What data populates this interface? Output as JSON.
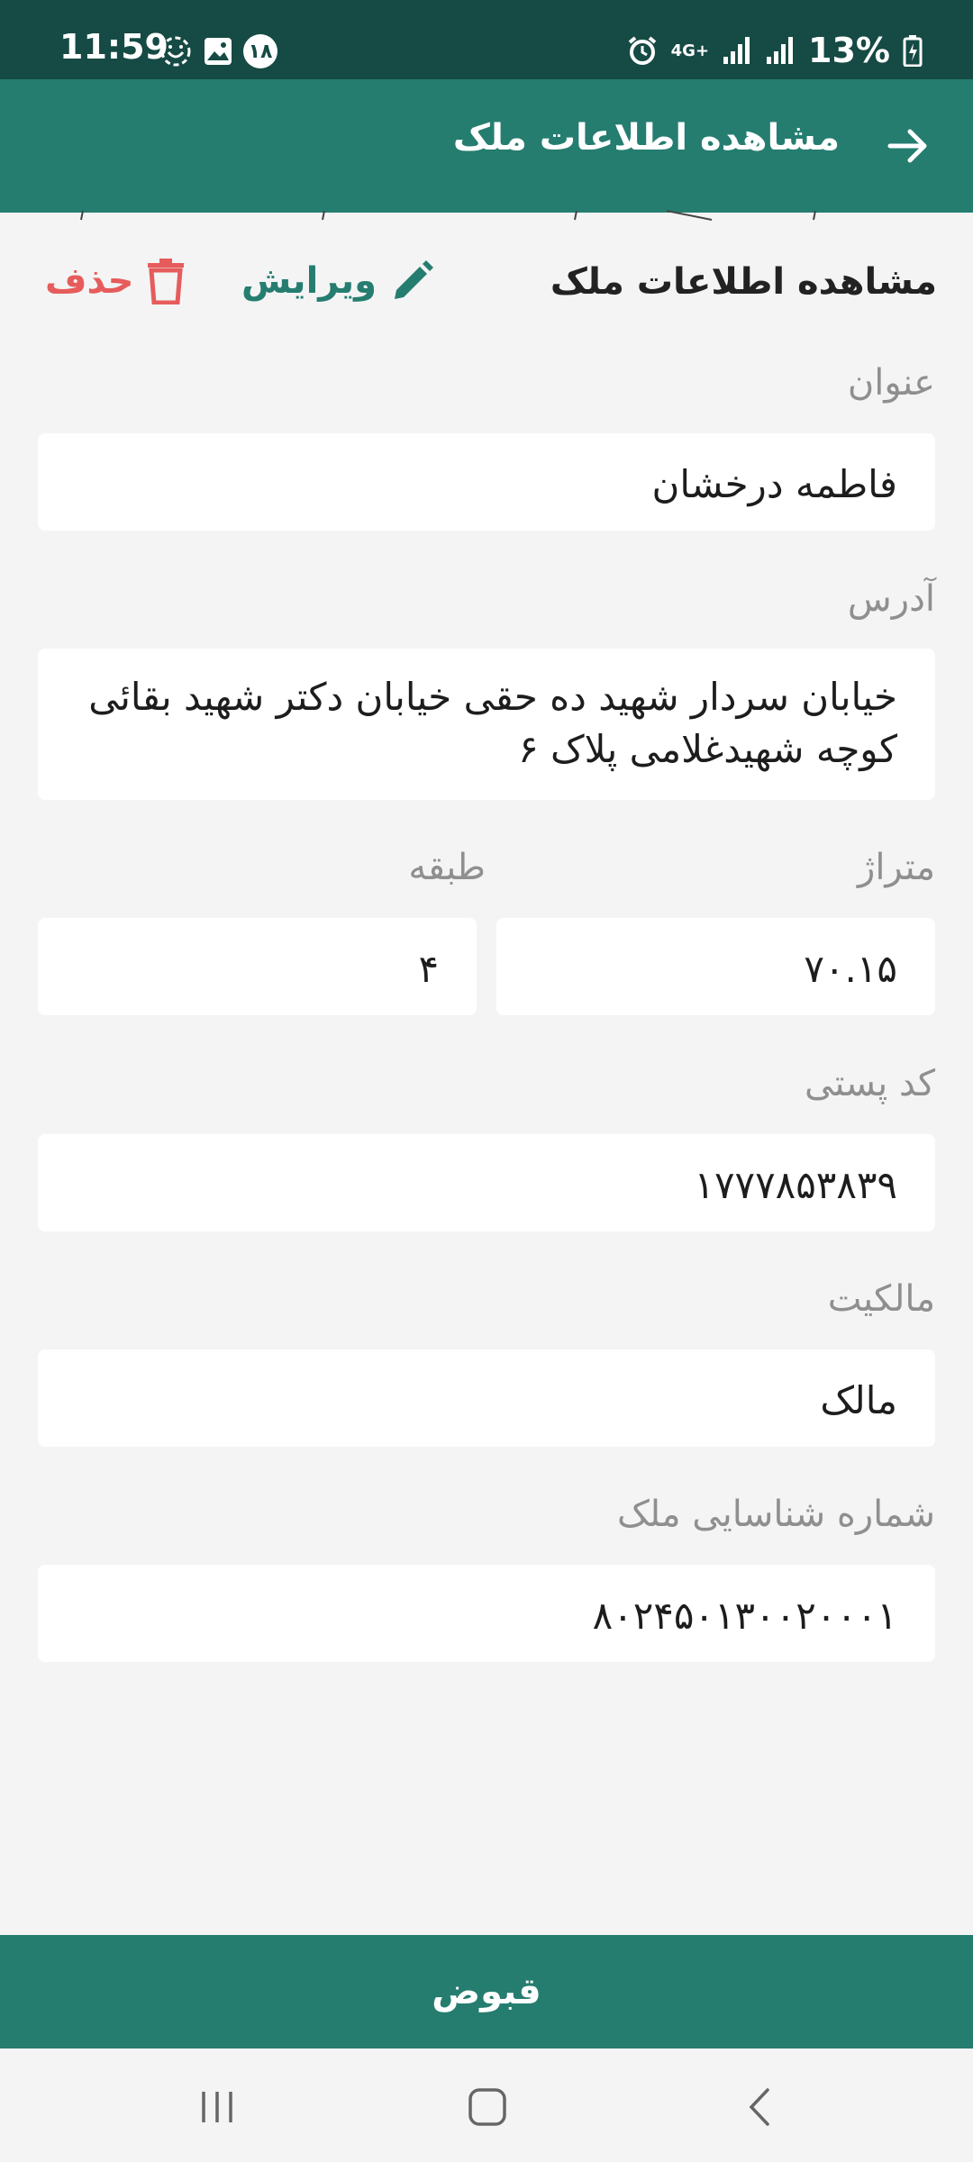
{
  "status_bar": {
    "time": "11:59",
    "notification_count": "۱۸",
    "network": "4G+",
    "battery": "13%",
    "icons": [
      "smile-icon",
      "gallery-icon",
      "badge-icon",
      "alarm-icon",
      "network-4g-icon",
      "signal-icon",
      "signal-icon",
      "battery-icon"
    ]
  },
  "app_bar": {
    "title": "مشاهده اطلاعات ملک",
    "back_icon": "arrow-right-icon"
  },
  "section": {
    "title": "مشاهده اطلاعات ملک",
    "edit_label": "ویرایش",
    "edit_icon": "pencil-icon",
    "delete_label": "حذف",
    "delete_icon": "trash-icon"
  },
  "fields": {
    "title_label": "عنوان",
    "title_value": "فاطمه درخشان",
    "address_label": "آدرس",
    "address_value": "خیابان سردار شهید ده حقی خیابان دکتر شهید بقائی کوچه شهیدغلامی پلاک ۶",
    "area_label": "متراژ",
    "area_value": "۷۰.۱۵",
    "floor_label": "طبقه",
    "floor_value": "۴",
    "postal_label": "کد پستی",
    "postal_value": "۱۷۷۷۸۵۳۸۳۹",
    "ownership_label": "مالکیت",
    "ownership_value": "مالک",
    "id_label": "شماره شناسایی ملک",
    "id_value": "۸۰۲۴۵۰۱۳۰۰۲۰۰۰۱"
  },
  "bottom_button": {
    "label": "قبوض"
  },
  "nav": {
    "icons": [
      "recent-apps-icon",
      "home-icon",
      "back-icon"
    ]
  },
  "colors": {
    "primary": "#257d70",
    "status_bar": "#164a44",
    "danger": "#e65c5c",
    "background": "#f4f4f4"
  }
}
